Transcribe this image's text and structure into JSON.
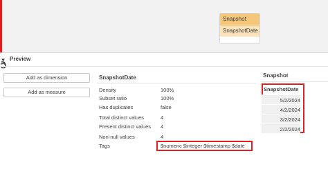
{
  "model_canvas": {
    "table_name": "Snapshot",
    "field_name": "SnapshotDate"
  },
  "preview": {
    "label": "Preview"
  },
  "buttons": {
    "add_dimension": "Add as dimension",
    "add_measure": "Add as measure"
  },
  "field_details": {
    "title": "SnapshotDate",
    "rows": [
      {
        "key": "Density",
        "value": "100%"
      },
      {
        "key": "Subset ratio",
        "value": "100%"
      },
      {
        "key": "Has duplicates",
        "value": "false"
      },
      {
        "key": "Total distinct values",
        "value": "4"
      },
      {
        "key": "Present distinct values",
        "value": "4"
      },
      {
        "key": "Non-null values",
        "value": "4"
      },
      {
        "key": "Tags",
        "value": "$numeric $integer $timestamp $date"
      }
    ]
  },
  "data_preview": {
    "table_title": "Snapshot",
    "column_header": "SnapshotDate",
    "values": [
      "5/2/2024",
      "4/2/2024",
      "3/2/2024",
      "2/2/2024"
    ]
  },
  "colors": {
    "table_header": "#f6c77a",
    "field_highlight": "#fbe2b8",
    "highlight_border": "#e02020"
  }
}
